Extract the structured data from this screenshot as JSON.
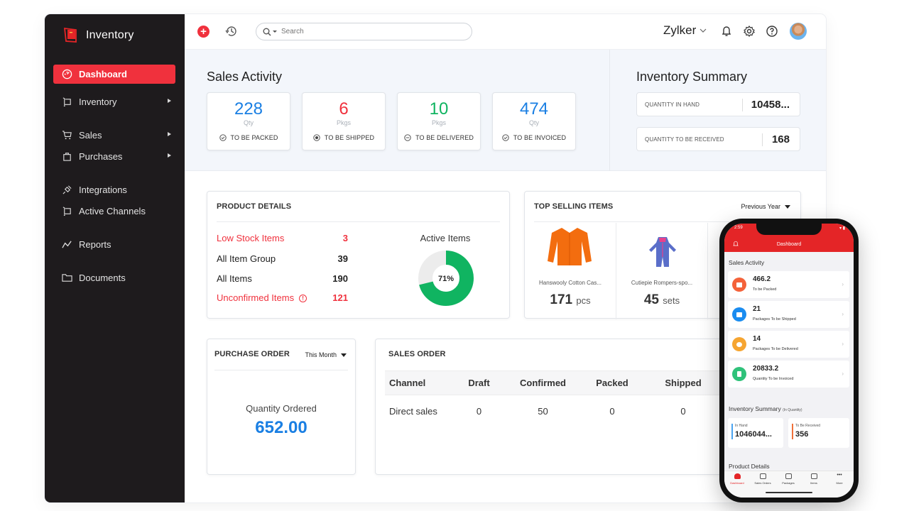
{
  "sidebar": {
    "brand": "Inventory",
    "items": [
      {
        "label": "Dashboard",
        "icon": "dashboard-gauge-icon",
        "active": true,
        "has_submenu": false
      },
      {
        "label": "Inventory",
        "icon": "inventory-cart-icon",
        "active": false,
        "has_submenu": true
      },
      {
        "label": "Sales",
        "icon": "shopping-cart-icon",
        "active": false,
        "has_submenu": true
      },
      {
        "label": "Purchases",
        "icon": "shopping-bag-icon",
        "active": false,
        "has_submenu": true
      },
      {
        "label": "Integrations",
        "icon": "plug-icon",
        "active": false,
        "has_submenu": false
      },
      {
        "label": "Active Channels",
        "icon": "channels-icon",
        "active": false,
        "has_submenu": false
      },
      {
        "label": "Reports",
        "icon": "line-chart-icon",
        "active": false,
        "has_submenu": false
      },
      {
        "label": "Documents",
        "icon": "folder-icon",
        "active": false,
        "has_submenu": false
      }
    ]
  },
  "topbar": {
    "search_placeholder": "Search",
    "org_name": "Zylker"
  },
  "sales_activity": {
    "title": "Sales Activity",
    "cards": [
      {
        "value": "228",
        "unit": "Qty",
        "label": "TO BE PACKED",
        "color": "#1a7fe3",
        "icon": "check-circle-icon"
      },
      {
        "value": "6",
        "unit": "Pkgs",
        "label": "TO BE SHIPPED",
        "color": "#f0313d",
        "icon": "radio-circle-icon"
      },
      {
        "value": "10",
        "unit": "Pkgs",
        "label": "TO BE DELIVERED",
        "color": "#10b461",
        "icon": "minus-circle-icon"
      },
      {
        "value": "474",
        "unit": "Qty",
        "label": "TO BE INVOICED",
        "color": "#1a7fe3",
        "icon": "check-circle-icon"
      }
    ]
  },
  "inventory_summary": {
    "title": "Inventory Summary",
    "rows": [
      {
        "label": "QUANTITY IN HAND",
        "value": "10458..."
      },
      {
        "label": "QUANTITY TO BE RECEIVED",
        "value": "168"
      }
    ]
  },
  "product_details": {
    "title": "PRODUCT DETAILS",
    "rows": [
      {
        "label": "Low Stock Items",
        "value": "3",
        "highlight": true
      },
      {
        "label": "All Item Group",
        "value": "39",
        "highlight": false
      },
      {
        "label": "All Items",
        "value": "190",
        "highlight": false
      },
      {
        "label": "Unconfirmed Items",
        "value": "121",
        "highlight": true
      }
    ],
    "active_items": {
      "title": "Active Items",
      "percent": 71,
      "percent_label": "71%",
      "color": "#10b461",
      "rest_color": "#ececec"
    }
  },
  "top_selling": {
    "title": "TOP SELLING ITEMS",
    "period": "Previous Year",
    "items": [
      {
        "name": "Hanswooly Cotton Cas...",
        "qty": "171",
        "unit": "pcs"
      },
      {
        "name": "Cutiepie Rompers-spo...",
        "qty": "45",
        "unit": "sets"
      }
    ]
  },
  "purchase_order": {
    "title": "PURCHASE ORDER",
    "period": "This Month",
    "label": "Quantity Ordered",
    "value": "652.00"
  },
  "sales_order": {
    "title": "SALES ORDER",
    "columns": [
      "Channel",
      "Draft",
      "Confirmed",
      "Packed",
      "Shipped"
    ],
    "rows": [
      [
        "Direct sales",
        "0",
        "50",
        "0",
        "0"
      ]
    ]
  },
  "phone": {
    "time": "2:59",
    "header_title": "Dashboard",
    "sales_activity_title": "Sales Activity",
    "cards": [
      {
        "value": "466.2",
        "label": "To be Packed",
        "color": "#f4623a"
      },
      {
        "value": "21",
        "label": "Packages To be Shipped",
        "color": "#1a8cf0"
      },
      {
        "value": "14",
        "label": "Packages To be Delivered",
        "color": "#f6a531"
      },
      {
        "value": "20833.2",
        "label": "Quantity To be Invoiced",
        "color": "#2fc27a"
      }
    ],
    "inventory_title": "Inventory Summary",
    "inventory_subtitle": "(In Quantity)",
    "in_hand_label": "In Hand",
    "in_hand_value": "1046044...",
    "to_receive_label": "To Be Received",
    "to_receive_value": "356",
    "product_details_title": "Product Details",
    "tabs": [
      {
        "label": "Dashboard",
        "active": true
      },
      {
        "label": "Sales Orders",
        "active": false
      },
      {
        "label": "Packages",
        "active": false
      },
      {
        "label": "Items",
        "active": false
      },
      {
        "label": "More",
        "active": false
      }
    ]
  }
}
